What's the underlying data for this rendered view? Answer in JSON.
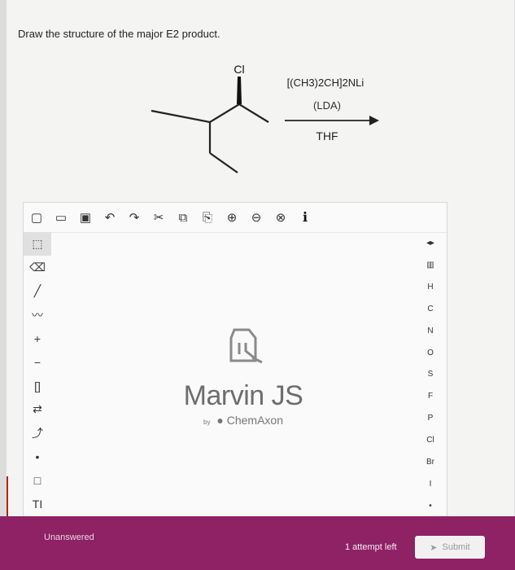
{
  "question": {
    "prompt": "Draw the structure of the major E2 product."
  },
  "reaction": {
    "substituent": "Cl",
    "reagent": "[(CH3)2CH]2NLi",
    "reagent_abbrev": "(LDA)",
    "solvent": "THF"
  },
  "editor": {
    "top_toolbar": [
      {
        "icon": "new-document-icon",
        "glyph": "▢"
      },
      {
        "icon": "open-folder-icon",
        "glyph": "▭"
      },
      {
        "icon": "save-icon",
        "glyph": "▣"
      },
      {
        "icon": "undo-icon",
        "glyph": "↶"
      },
      {
        "icon": "redo-icon",
        "glyph": "↷"
      },
      {
        "icon": "cut-icon",
        "glyph": "✂"
      },
      {
        "icon": "copy-icon",
        "glyph": "⧉"
      },
      {
        "icon": "paste-icon",
        "glyph": "⎘"
      },
      {
        "icon": "zoom-in-icon",
        "glyph": "⊕"
      },
      {
        "icon": "zoom-out-icon",
        "glyph": "⊖"
      },
      {
        "icon": "zoom-reset-icon",
        "glyph": "⊗"
      },
      {
        "icon": "info-icon",
        "glyph": "ℹ"
      }
    ],
    "left_tools": [
      {
        "icon": "select-icon",
        "glyph": "⬚"
      },
      {
        "icon": "eraser-icon",
        "glyph": "⌫"
      },
      {
        "icon": "single-bond-icon",
        "glyph": "╱"
      },
      {
        "icon": "chain-icon",
        "glyph": "〰"
      },
      {
        "icon": "positive-charge-icon",
        "glyph": "+"
      },
      {
        "icon": "negative-charge-icon",
        "glyph": "−"
      },
      {
        "icon": "bracket-icon",
        "glyph": "[]"
      },
      {
        "icon": "reaction-arrow-icon",
        "glyph": "⇄"
      },
      {
        "icon": "electron-flow-icon",
        "glyph": "⤴"
      },
      {
        "icon": "radical-icon",
        "glyph": "•"
      },
      {
        "icon": "rectangle-icon",
        "glyph": "□"
      },
      {
        "icon": "text-icon",
        "glyph": "TI"
      }
    ],
    "right_tools": {
      "expand_glyph": "◂▸",
      "periodic_table_glyph": "▥",
      "elements": [
        "H",
        "C",
        "N",
        "O",
        "S",
        "F",
        "P",
        "Cl",
        "Br",
        "I"
      ],
      "more_glyph": "•"
    },
    "logo": {
      "title": "Marvin JS",
      "by": "by",
      "vendor": "ChemAxon"
    }
  },
  "footer": {
    "status": "Unanswered",
    "attempts": "1 attempt left",
    "submit_label": "Submit",
    "submit_icon": "send-icon"
  },
  "colors": {
    "footer_bg": "#8e2265",
    "accent_red": "#b91c1c"
  }
}
